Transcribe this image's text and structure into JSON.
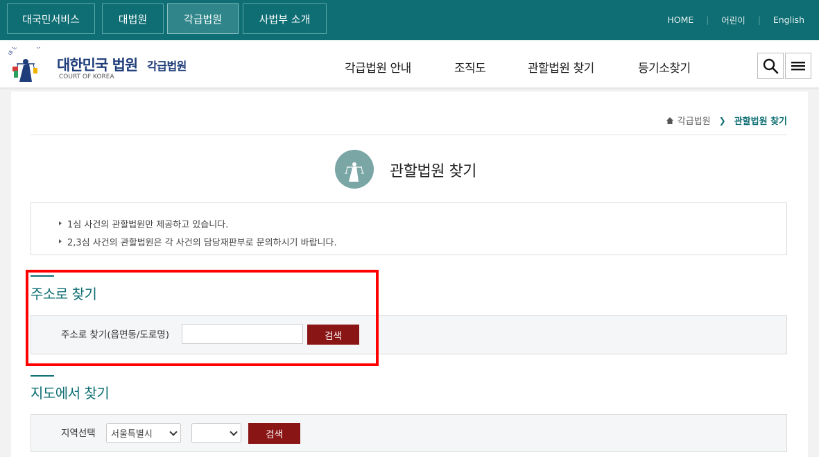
{
  "topbar": {
    "tabs": [
      {
        "label": "대국민서비스"
      },
      {
        "label": "대법원"
      },
      {
        "label": "각급법원"
      },
      {
        "label": "사법부 소개"
      }
    ],
    "links": [
      "HOME",
      "어린이",
      "English"
    ]
  },
  "header": {
    "logo_title": "대한민국 법원",
    "logo_subtitle": "각급법원",
    "logo_english": "COURT OF KOREA",
    "emblem_text": "대 한 민 국 법 원",
    "nav": [
      "각급법원 안내",
      "조직도",
      "관할법원 찾기",
      "등기소찾기"
    ]
  },
  "breadcrumb": {
    "parent": "각급법원",
    "current": "관할법원 찾기"
  },
  "page": {
    "title": "관할법원 찾기"
  },
  "notice": [
    "1심 사건의 관할법원만 제공하고 있습니다.",
    "2,3심 사건의 관할법원은 각 사건의 담당재판부로 문의하시기 바랍니다."
  ],
  "address_search": {
    "section_title": "주소로 찾기",
    "label": "주소로 찾기(읍면동/도로명)",
    "input_value": "",
    "button_label": "검색"
  },
  "map_search": {
    "section_title": "지도에서 찾기",
    "label": "지역선택",
    "region_selected": "서울특별시",
    "subregion_selected": "",
    "button_label": "검색"
  },
  "colors": {
    "primary": "#0e6e73",
    "button": "#8a1515",
    "highlight": "#ff0000"
  }
}
